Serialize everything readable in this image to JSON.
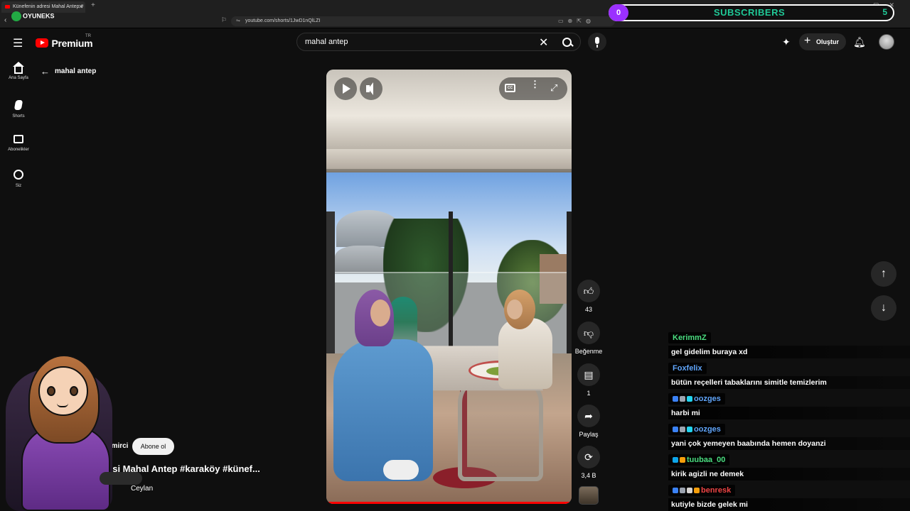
{
  "browser": {
    "tab_title": "Künefenin adresi Mahal Antep #",
    "url": "youtube.com/shorts/1JwD1nQlLZI"
  },
  "overlay": {
    "logo_text": "OYUNEKS",
    "subscribers_label": "SUBSCRIBERS",
    "subscriber_count": "0",
    "subscriber_goal": "5"
  },
  "masthead": {
    "logo_word": "Premium",
    "country_code": "TR",
    "search_value": "mahal antep",
    "create_label": "Oluştur"
  },
  "sidebar": {
    "items": [
      {
        "label": "Ana Sayfa"
      },
      {
        "label": "Shorts"
      },
      {
        "label": "Abonelikler"
      },
      {
        "label": "Siz"
      }
    ],
    "back_label": "mahal antep"
  },
  "short": {
    "channel": "emirci",
    "subscribe_label": "Abone ol",
    "title": "esi Mahal Antep #karaköy #künef...",
    "sound": "Ceylan",
    "cc_label": "CC",
    "progress": 1.0
  },
  "actions": {
    "likes": "43",
    "dislike_label": "Beğenme",
    "comments": "1",
    "share_label": "Paylaş",
    "remix": "3,4 B"
  },
  "chat": [
    {
      "user": "KerimmZ",
      "color": "#4ade80",
      "message": "gel gidelim buraya xd",
      "badges": []
    },
    {
      "user": "Foxfelix",
      "color": "#60a5fa",
      "message": "bütün reçelleri tabaklarını simitle temizlerim",
      "badges": []
    },
    {
      "user": "oozges",
      "color": "#60a5fa",
      "message": "harbi mi",
      "badges": [
        "#3b82f6",
        "#9ca3af",
        "#22d3ee"
      ]
    },
    {
      "user": "oozges",
      "color": "#60a5fa",
      "message": "yani çok yemeyen baabında hemen doyanzi",
      "badges": [
        "#3b82f6",
        "#9ca3af",
        "#22d3ee"
      ]
    },
    {
      "user": "tuubaa_00",
      "color": "#4ade80",
      "message": "kirik agizli ne demek",
      "badges": [
        "#0ea5e9",
        "#f59e0b"
      ]
    },
    {
      "user": "benresk",
      "color": "#ef4444",
      "message": "kutiyle bizde gelek mi",
      "badges": [
        "#3b82f6",
        "#9ca3af",
        "#d6d3d1",
        "#f59e0b"
      ]
    }
  ]
}
